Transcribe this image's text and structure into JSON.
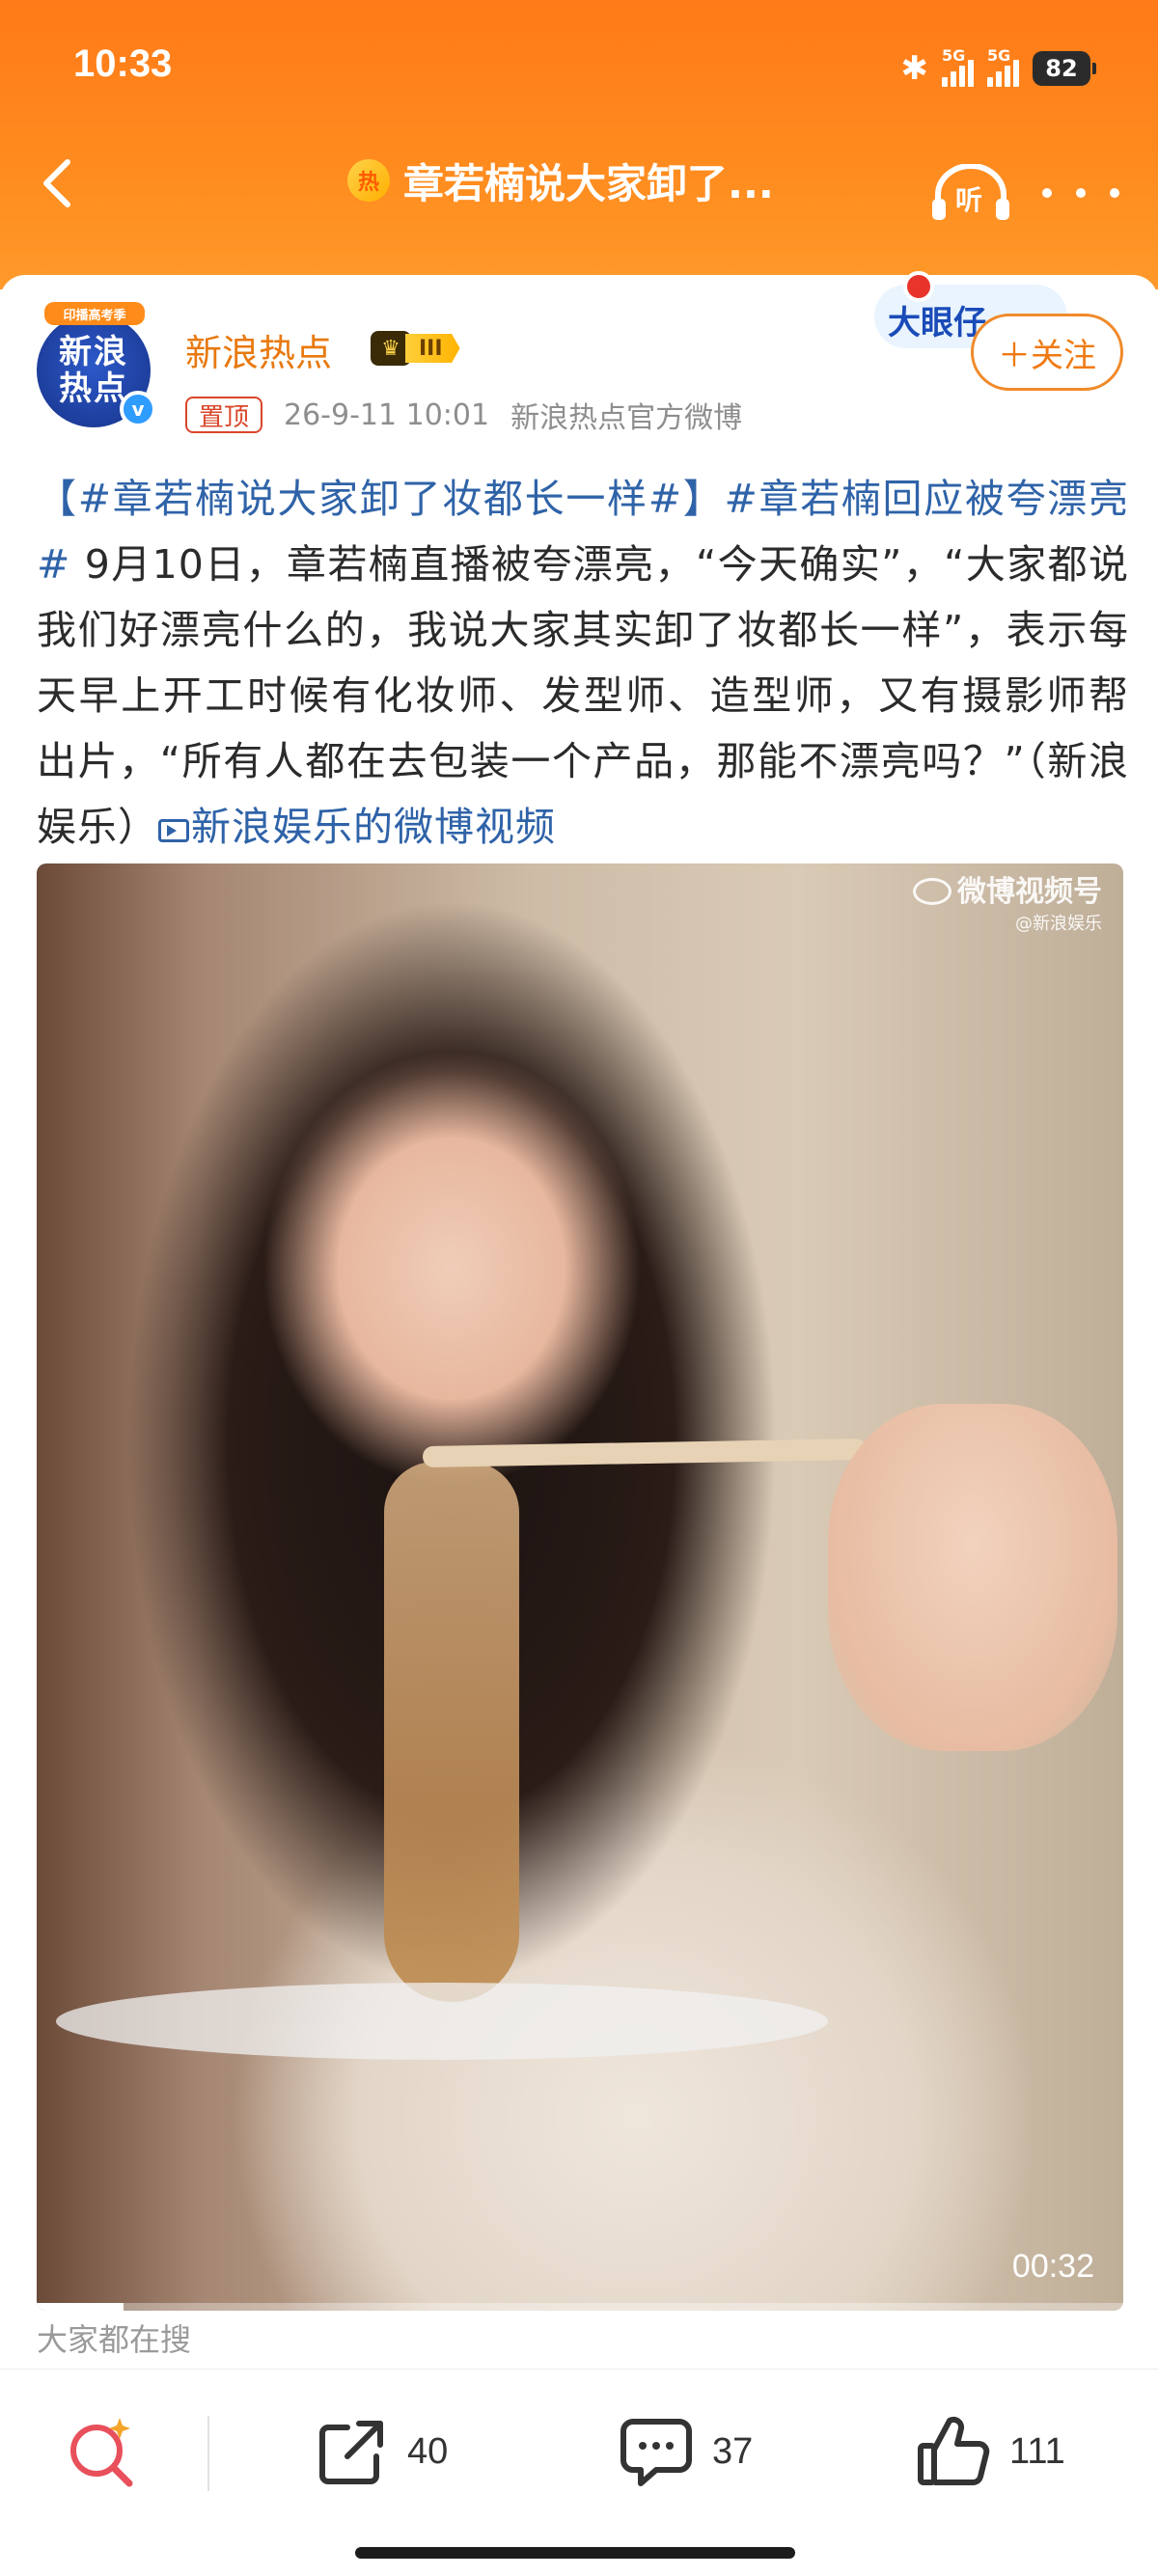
{
  "status_bar": {
    "time": "10:33",
    "sim1_tag": "5G",
    "sim2_tag": "5G",
    "battery": "82",
    "bluetooth_glyph": "✱"
  },
  "nav": {
    "hot_badge": "热",
    "title": "章若楠说大家卸了...",
    "listen_label": "听"
  },
  "post": {
    "author": {
      "avatar_ribbon": "印播高考季",
      "avatar_line1": "新浪",
      "avatar_line2": "热点",
      "verified_glyph": "v",
      "name": "新浪热点",
      "level_crown": "♛",
      "level": "III"
    },
    "pinned": "置顶",
    "timestamp": "26-9-11 10:01",
    "source": "新浪热点官方微博",
    "promo_sticker": "大眼仔",
    "follow_label": "＋关注",
    "text": {
      "topic1": "【#章若楠说大家卸了妆都长一样#】",
      "topic2": "#章若楠回应被夸漂亮#",
      "body": " 9月10日，章若楠直播被夸漂亮，“今天确实”，“大家都说我们好漂亮什么的，我说大家其实卸了妆都长一样”，表示每天早上开工时候有化妆师、发型师、造型师，又有摄影师帮出片，“所有人都在去包装一个产品，那能不漂亮吗？”（新浪娱乐）",
      "video_link": "新浪娱乐的微博视频"
    },
    "video": {
      "watermark": "微博视频号",
      "watermark_sub": "@新浪娱乐",
      "duration": "00:32",
      "progress": 0.08
    },
    "related_label": "大家都在搜"
  },
  "bottom_bar": {
    "share_count": "40",
    "comment_count": "37",
    "like_count": "111"
  },
  "colors": {
    "header_orange": "#ff8a1e",
    "author_name": "#e8790f",
    "topic_link": "#2f63a8",
    "follow_accent": "#f07a12",
    "pinned_red": "#d9472b"
  }
}
